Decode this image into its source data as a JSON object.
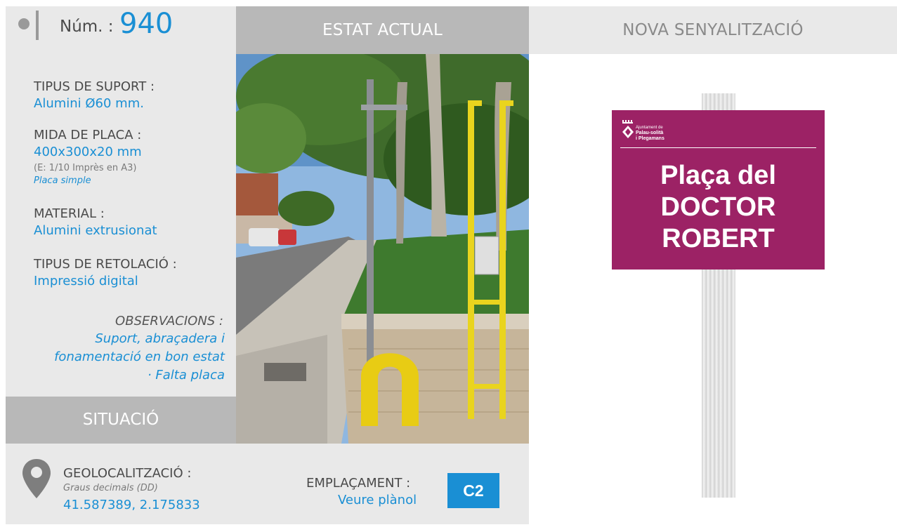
{
  "header": {
    "num_label": "Núm. :",
    "num_value": "940",
    "estat_actual": "ESTAT ACTUAL",
    "nova_senyalitzacio": "NOVA SENYALITZACIÓ"
  },
  "info": {
    "tipus_suport_label": "TIPUS DE SUPORT :",
    "tipus_suport_value": "Alumini Ø60 mm.",
    "mida_placa_label": "MIDA DE PLACA :",
    "mida_placa_value": "400x300x20 mm",
    "mida_placa_scale": "(E: 1/10 Imprès en A3)",
    "mida_placa_type": "Placa simple",
    "material_label": "MATERIAL :",
    "material_value": "Alumini extrusionat",
    "retolacio_label": "TIPUS DE RETOLACIÓ :",
    "retolacio_value": "Impressió digital",
    "observacions_label": "OBSERVACIONS :",
    "observacions_lines": [
      "Suport, abraçadera i",
      "fonamentació en bon estat",
      "· Falta placa"
    ]
  },
  "situacio": {
    "title": "SITUACIÓ",
    "geo_label": "GEOLOCALITZACIÓ :",
    "geo_sub": "Graus decimals (DD)",
    "geo_value": "41.587389, 2.175833",
    "emplacament_label": "EMPLAÇAMENT :",
    "emplacament_link": "Veure plànol",
    "emplacament_code": "C2"
  },
  "sign": {
    "logo_line1": "Ajuntament de",
    "logo_line2": "Palau-solità",
    "logo_line3": "i Plegamans",
    "text_lines": [
      "Plaça del",
      "DOCTOR",
      "ROBERT"
    ]
  },
  "colors": {
    "accent_blue": "#1a8fd4",
    "sign_magenta": "#9c2265",
    "panel_gray": "#e9e9e9",
    "header_gray": "#b8b8b8"
  }
}
